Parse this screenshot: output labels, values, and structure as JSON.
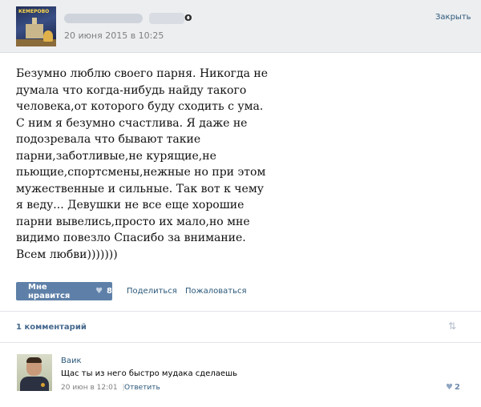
{
  "header": {
    "author_name_visible": "о",
    "date": "20 июня 2015 в 10:25",
    "close_label": "Закрыть",
    "avatar_logo_text": "КЕМЕРОВО"
  },
  "post": {
    "lines": [
      "Безумно люблю своего парня. Никогда не",
      "думала что когда-нибудь найду такого",
      "человека,от которого буду сходить с ума.",
      "С ним я безумно счастлива. Я даже не",
      "подозревала что бывают такие",
      "парни,заботливые,не курящие,не",
      "пьющие,спортсмены,нежные но при этом",
      "мужественные и сильные. Так вот к чему",
      "я веду... Девушки не все еще хорошие",
      "парни вывелись,просто их мало,но мне",
      "видимо повезло Спасибо за внимание.",
      "Всем любви)))))))"
    ]
  },
  "actions": {
    "like_label": "Мне нравится",
    "like_count": "8",
    "share_label": "Поделиться",
    "report_label": "Пожаловаться"
  },
  "comments": {
    "count_label": "1 комментарий",
    "items": [
      {
        "name": "Ваик",
        "text": "Щас ты из него быстро мудака сделаешь",
        "date": "20 июн в 12:01",
        "separator": "|",
        "reply_label": "Ответить",
        "likes": "2"
      }
    ]
  },
  "colors": {
    "link": "#2b587a",
    "button": "#5e80a8",
    "header_bg": "#edeef0"
  }
}
